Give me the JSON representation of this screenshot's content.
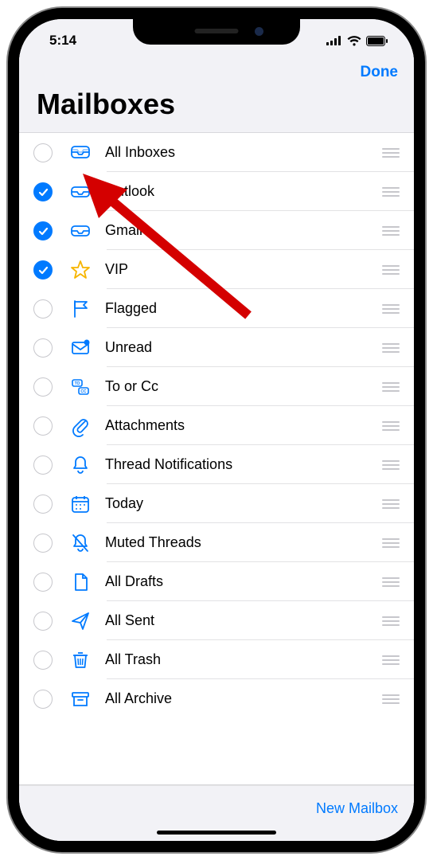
{
  "statusbar": {
    "time": "5:14"
  },
  "navbar": {
    "done_label": "Done"
  },
  "title": "Mailboxes",
  "footer": {
    "new_mailbox_label": "New Mailbox"
  },
  "mailboxes": [
    {
      "label": "All Inboxes",
      "checked": false,
      "icon": "all-inboxes",
      "color": "#007aff"
    },
    {
      "label": "Outlook",
      "checked": true,
      "icon": "inbox",
      "color": "#007aff"
    },
    {
      "label": "Gmail",
      "checked": true,
      "icon": "inbox",
      "color": "#007aff"
    },
    {
      "label": "VIP",
      "checked": true,
      "icon": "star",
      "color": "#f7b500"
    },
    {
      "label": "Flagged",
      "checked": false,
      "icon": "flag",
      "color": "#007aff"
    },
    {
      "label": "Unread",
      "checked": false,
      "icon": "unread",
      "color": "#007aff"
    },
    {
      "label": "To or Cc",
      "checked": false,
      "icon": "tocc",
      "color": "#007aff"
    },
    {
      "label": "Attachments",
      "checked": false,
      "icon": "paperclip",
      "color": "#007aff"
    },
    {
      "label": "Thread Notifications",
      "checked": false,
      "icon": "bell",
      "color": "#007aff"
    },
    {
      "label": "Today",
      "checked": false,
      "icon": "calendar",
      "color": "#007aff"
    },
    {
      "label": "Muted Threads",
      "checked": false,
      "icon": "bell-slash",
      "color": "#007aff"
    },
    {
      "label": "All Drafts",
      "checked": false,
      "icon": "draft",
      "color": "#007aff"
    },
    {
      "label": "All Sent",
      "checked": false,
      "icon": "sent",
      "color": "#007aff"
    },
    {
      "label": "All Trash",
      "checked": false,
      "icon": "trash",
      "color": "#007aff"
    },
    {
      "label": "All Archive",
      "checked": false,
      "icon": "archive",
      "color": "#007aff"
    }
  ]
}
